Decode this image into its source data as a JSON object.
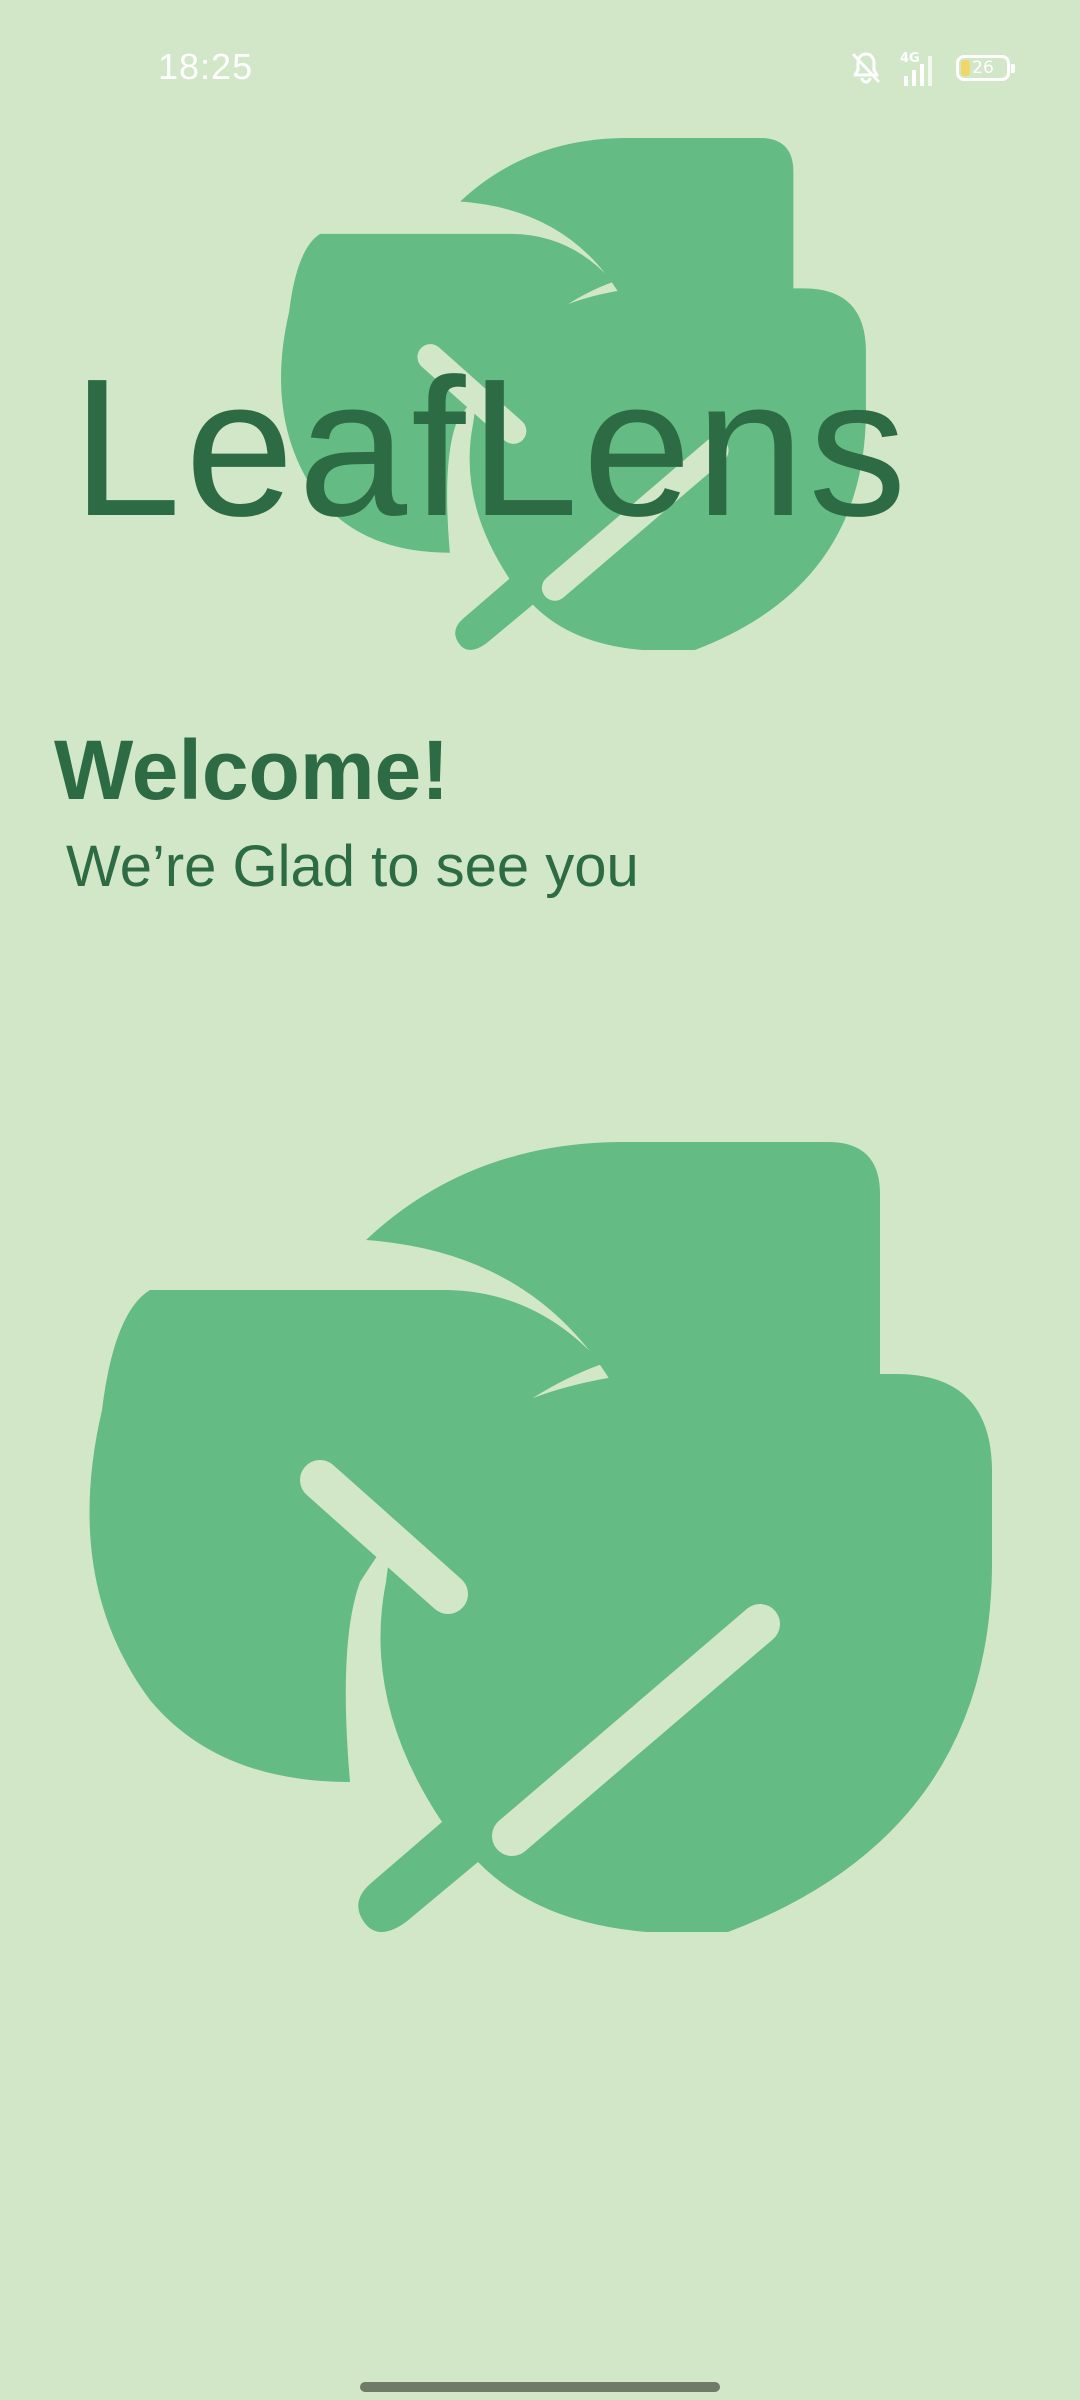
{
  "status_bar": {
    "time": "18:25",
    "network": "4G",
    "battery": "26",
    "icons": [
      "bell-off-icon",
      "signal-icon",
      "battery-icon"
    ]
  },
  "app": {
    "title": "LeafLens",
    "logo_icon": "leaves-icon"
  },
  "welcome": {
    "title": "Welcome!",
    "subtitle": "We’re Glad to see you"
  },
  "illustration": {
    "icon": "leaves-icon"
  },
  "colors": {
    "background": "#d2e7c8",
    "leaf": "#64bb84",
    "text": "#2d6b45"
  }
}
